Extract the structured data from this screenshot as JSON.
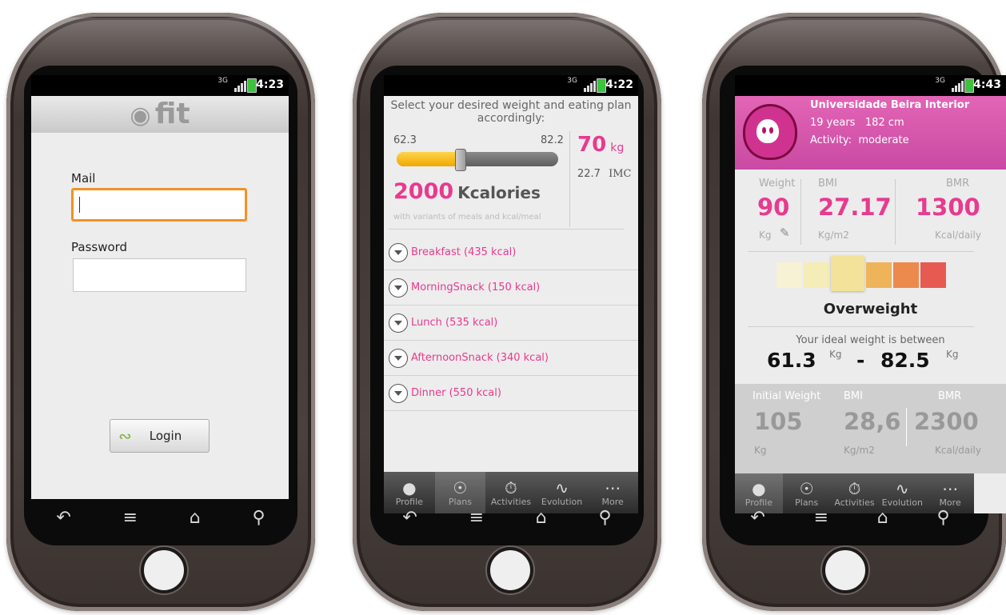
{
  "screens": {
    "login": {
      "status_time": "4:23",
      "network": "3G",
      "logo_text": "fit",
      "mail_label": "Mail",
      "mail_value": "",
      "password_label": "Password",
      "password_value": "",
      "login_label": "Login"
    },
    "plans": {
      "status_time": "4:22",
      "network": "3G",
      "instruction": "Select your desired weight and eating plan accordingly:",
      "range_min": "62.3",
      "range_max": "82.2",
      "slider_fraction": 0.39,
      "weight_value": "70",
      "weight_unit": "kg",
      "imc_value": "22.7",
      "imc_label": "IMC",
      "kcal_value": "2000",
      "kcal_label": "Kcalories",
      "kcal_sub": "with variants of meals and kcal/meal",
      "meals": [
        "Breakfast (435 kcal)",
        "MorningSnack (150 kcal)",
        "Lunch (535 kcal)",
        "AfternoonSnack (340 kcal)",
        "Dinner (550 kcal)"
      ],
      "active_tab": "Plans"
    },
    "profile": {
      "status_time": "4:43",
      "network": "3G",
      "name": "Universidade Beira Interior",
      "age_height": "19 years   182 cm",
      "activity": "Activity:  moderate",
      "weight_label": "Weight",
      "weight_value": "90",
      "weight_unit": "Kg",
      "bmi_label": "BMI",
      "bmi_value": "27.17",
      "bmi_unit": "Kg/m2",
      "bmr_label": "BMR",
      "bmr_value": "1300",
      "bmr_unit": "Kcal/daily",
      "category": "Overweight",
      "scale_colors": [
        "#f7f2d4",
        "#f4edb8",
        "#f3e39a",
        "#efb35a",
        "#ec8a4e",
        "#e75a52"
      ],
      "scale_active_index": 2,
      "ideal_text": "Your ideal weight is between",
      "ideal_min": "61.3",
      "ideal_max": "82.5",
      "ideal_unit": "Kg",
      "ideal_dash": "-",
      "initial_label": "Initial Weight",
      "initial_value": "105",
      "initial_unit": "Kg",
      "init_bmi_label": "BMI",
      "init_bmi_value": "28,6",
      "init_bmi_unit": "Kg/m2",
      "init_bmr_label": "BMR",
      "init_bmr_value": "2300",
      "init_bmr_unit": "Kcal/daily",
      "active_tab": "Profile"
    }
  },
  "tabs": [
    "Profile",
    "Plans",
    "Activities",
    "Evolution",
    "More"
  ],
  "tab_icons": [
    "apple-icon",
    "plate-icon",
    "stopwatch-icon",
    "chart-line-icon",
    "more-icon"
  ],
  "nav_icons": [
    "back-icon",
    "menu-icon",
    "home-icon",
    "search-icon"
  ]
}
